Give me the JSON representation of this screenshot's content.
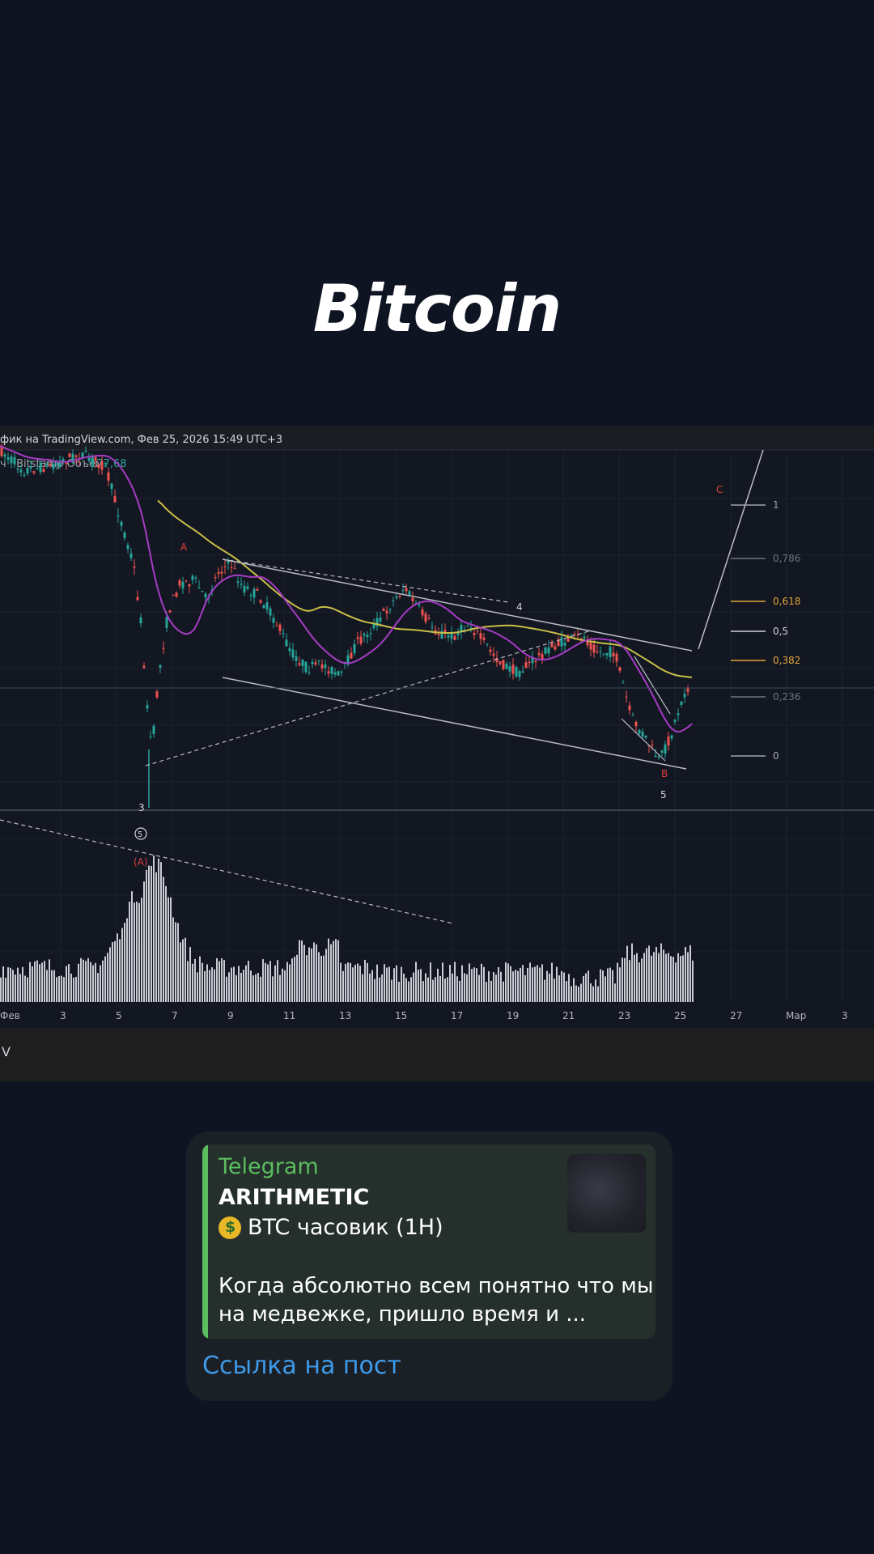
{
  "title": "Bitcoin",
  "chart": {
    "header": "фик на TradingView.com, Фев 25, 2026 15:49 UTC+3",
    "symbol_line": "ч · Bitstamp  Объем",
    "volume_value": "177,68",
    "x_axis_labels": [
      "Фев",
      "3",
      "5",
      "7",
      "9",
      "11",
      "13",
      "15",
      "17",
      "19",
      "21",
      "23",
      "25",
      "27",
      "Мар",
      "3"
    ],
    "fib_levels": [
      "1",
      "0,786",
      "0,618",
      "0,5",
      "0,382",
      "0,236",
      "0"
    ],
    "wave_labels": {
      "c": "C",
      "a": "A",
      "four": "4",
      "b": "B",
      "five": "5",
      "three": "3",
      "circle_five": "5",
      "paren_a": "(A)"
    },
    "footer": "V"
  },
  "card": {
    "site": "Telegram",
    "title": "ARITHMETIC",
    "subtitle": "BTC часовик (1H)",
    "description": "Когда абсолютно всем понятно что мы на медвежке, пришло время и ...",
    "link": "Ссылка на пост"
  },
  "colors": {
    "background": "#0f1423",
    "card": "#1b1f26",
    "preview": "#25302c",
    "accent_green": "#5bbd5f",
    "link_blue": "#3e9be9"
  }
}
